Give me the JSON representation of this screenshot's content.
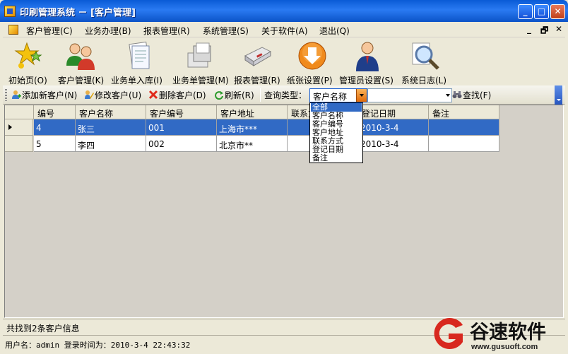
{
  "window": {
    "title": "印刷管理系统 － [客户管理]"
  },
  "menu": {
    "items": [
      "客户管理(C)",
      "业务办理(B)",
      "报表管理(R)",
      "系统管理(S)",
      "关于软件(A)",
      "退出(Q)"
    ],
    "mdi": {
      "minimize": "_",
      "restore": "🗗",
      "close": "✕"
    }
  },
  "toolbar": {
    "buttons": [
      {
        "label": "初始页(O)",
        "icon": "stars-icon"
      },
      {
        "label": "客户管理(K)",
        "icon": "users-icon"
      },
      {
        "label": "业务单入库(I)",
        "icon": "documents-icon"
      },
      {
        "label": "业务单管理(M)",
        "icon": "pages-icon"
      },
      {
        "label": "报表管理(R)",
        "icon": "printer-icon"
      },
      {
        "label": "纸张设置(P)",
        "icon": "download-icon"
      },
      {
        "label": "管理员设置(S)",
        "icon": "admin-icon"
      },
      {
        "label": "系统日志(L)",
        "icon": "magnifier-icon"
      }
    ]
  },
  "actions": {
    "add": "添加新客户(N)",
    "edit": "修改客户(U)",
    "delete": "删除客户(D)",
    "refresh": "刷新(R)",
    "query_label": "查询类型：",
    "query_type": "客户名称",
    "query_value": "",
    "find": "查找(F)"
  },
  "query_options": [
    "全部",
    "客户名称",
    "客户编号",
    "客户地址",
    "联系方式",
    "登记日期",
    "备注"
  ],
  "query_highlight": "全部",
  "table": {
    "columns": [
      "编号",
      "客户名称",
      "客户编号",
      "客户地址",
      "联系方式",
      "登记日期",
      "备注"
    ],
    "rows": [
      [
        "4",
        "张三",
        "001",
        "上海市***",
        "",
        "2010-3-4",
        ""
      ],
      [
        "5",
        "李四",
        "002",
        "北京市**",
        "",
        "2010-3-4",
        ""
      ]
    ],
    "selected_row": 0
  },
  "status": {
    "found": "共找到2条客户信息",
    "user": "用户名：admin  登录时间为：2010-3-4 22:43:32"
  },
  "watermark": {
    "text": "谷速软件",
    "url": "www.gusuoft.com"
  }
}
